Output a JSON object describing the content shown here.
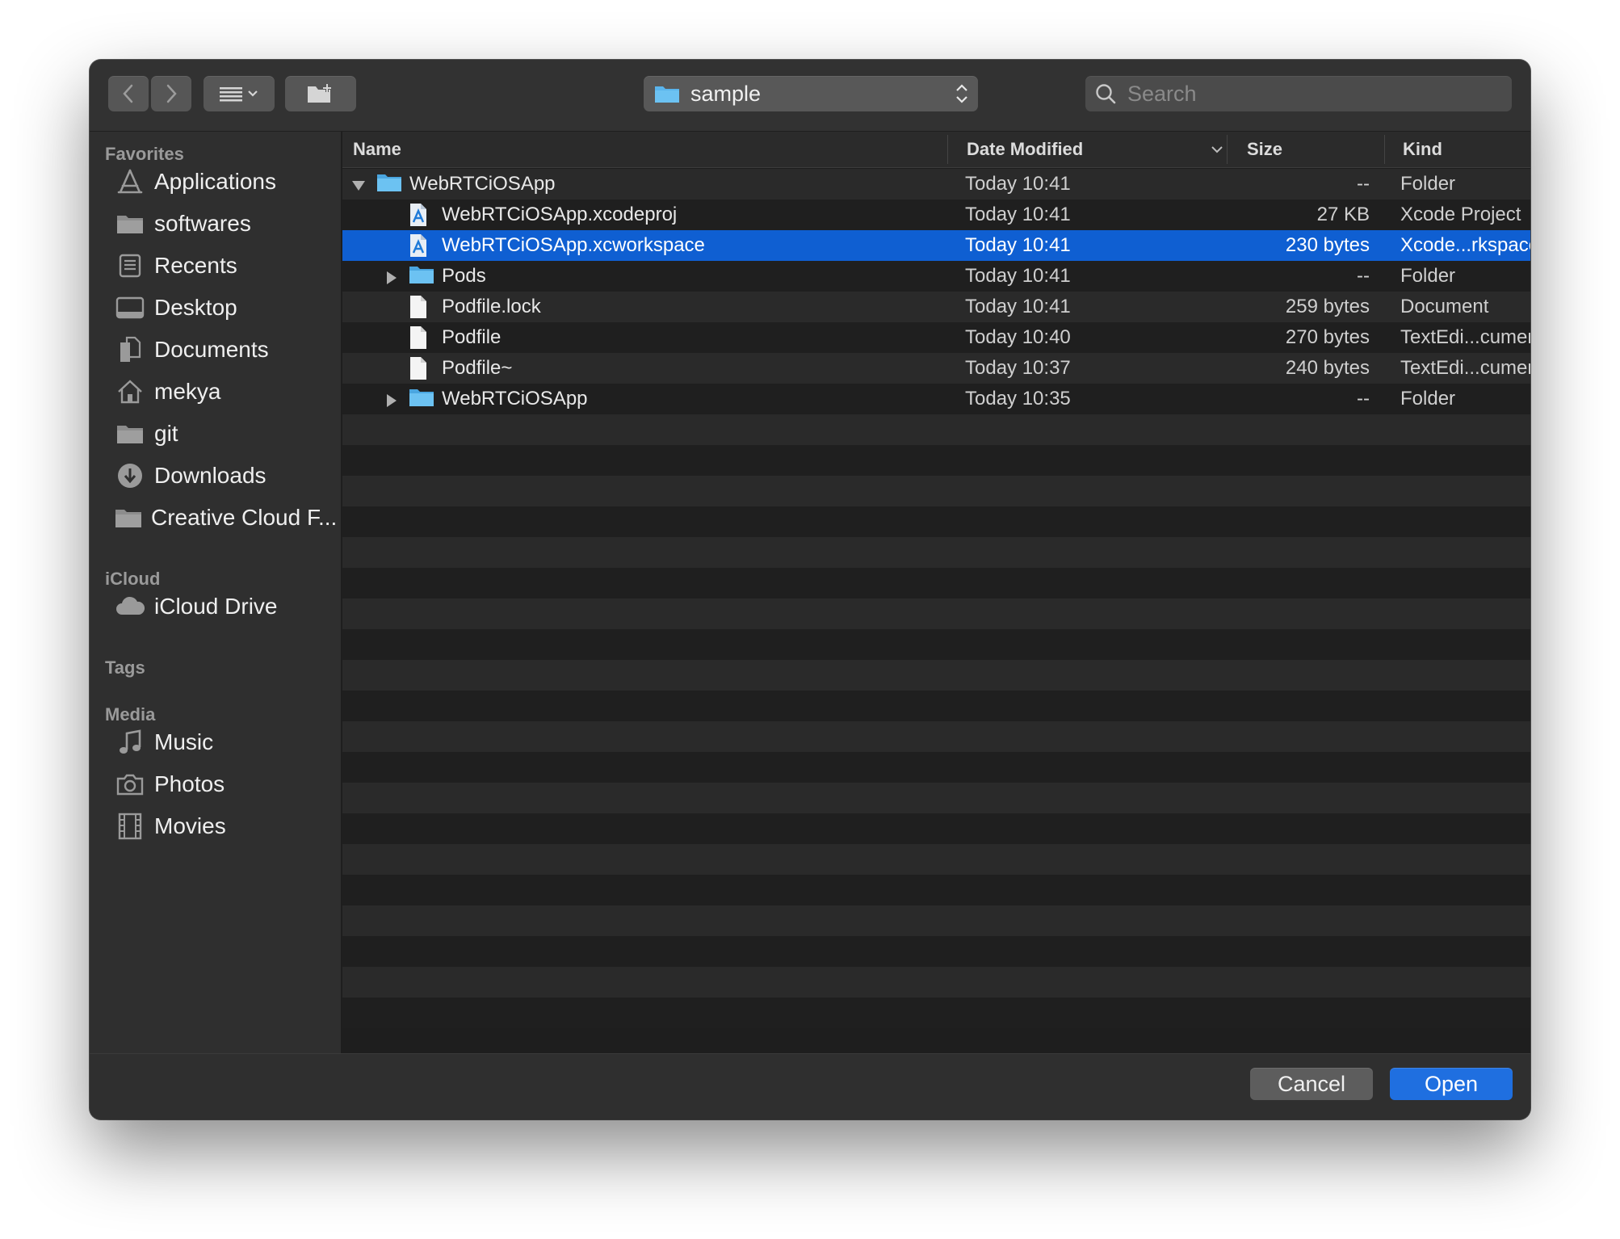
{
  "toolbar": {
    "path_label": "sample",
    "search_placeholder": "Search"
  },
  "sidebar": {
    "favorites_title": "Favorites",
    "favorites": [
      {
        "label": "Applications",
        "icon": "applications-icon"
      },
      {
        "label": "softwares",
        "icon": "folder-icon"
      },
      {
        "label": "Recents",
        "icon": "recents-icon"
      },
      {
        "label": "Desktop",
        "icon": "desktop-icon"
      },
      {
        "label": "Documents",
        "icon": "documents-icon"
      },
      {
        "label": "mekya",
        "icon": "home-icon"
      },
      {
        "label": "git",
        "icon": "folder-icon"
      },
      {
        "label": "Downloads",
        "icon": "downloads-icon"
      },
      {
        "label": "Creative Cloud F...",
        "icon": "folder-icon"
      }
    ],
    "icloud_title": "iCloud",
    "icloud": [
      {
        "label": "iCloud Drive",
        "icon": "cloud-icon"
      }
    ],
    "tags_title": "Tags",
    "media_title": "Media",
    "media": [
      {
        "label": "Music",
        "icon": "music-icon"
      },
      {
        "label": "Photos",
        "icon": "camera-icon"
      },
      {
        "label": "Movies",
        "icon": "film-icon"
      }
    ]
  },
  "columns": {
    "name": "Name",
    "date": "Date Modified",
    "size": "Size",
    "kind": "Kind"
  },
  "files": [
    {
      "name": "WebRTCiOSApp",
      "date": "Today 10:41",
      "size": "--",
      "kind": "Folder",
      "icon": "folder-icon",
      "indent": 0,
      "disclosure": "expanded"
    },
    {
      "name": "WebRTCiOSApp.xcodeproj",
      "date": "Today 10:41",
      "size": "27 KB",
      "kind": "Xcode Project",
      "icon": "xcode-icon",
      "indent": 1,
      "disclosure": "none"
    },
    {
      "name": "WebRTCiOSApp.xcworkspace",
      "date": "Today 10:41",
      "size": "230 bytes",
      "kind": "Xcode...rkspace",
      "icon": "xcode-icon",
      "indent": 1,
      "disclosure": "none",
      "selected": true
    },
    {
      "name": "Pods",
      "date": "Today 10:41",
      "size": "--",
      "kind": "Folder",
      "icon": "folder-icon",
      "indent": 1,
      "disclosure": "collapsed"
    },
    {
      "name": "Podfile.lock",
      "date": "Today 10:41",
      "size": "259 bytes",
      "kind": "Document",
      "icon": "document-icon",
      "indent": 1,
      "disclosure": "none"
    },
    {
      "name": "Podfile",
      "date": "Today 10:40",
      "size": "270 bytes",
      "kind": "TextEdi...cument",
      "icon": "document-icon",
      "indent": 1,
      "disclosure": "none"
    },
    {
      "name": "Podfile~",
      "date": "Today 10:37",
      "size": "240 bytes",
      "kind": "TextEdi...cument",
      "icon": "document-icon",
      "indent": 1,
      "disclosure": "none"
    },
    {
      "name": "WebRTCiOSApp",
      "date": "Today 10:35",
      "size": "--",
      "kind": "Folder",
      "icon": "folder-icon",
      "indent": 1,
      "disclosure": "collapsed"
    }
  ],
  "footer": {
    "cancel_label": "Cancel",
    "open_label": "Open"
  },
  "colors": {
    "selection": "#0f5fd2",
    "accent": "#1f6fe0",
    "folder": "#5ab4ec"
  }
}
